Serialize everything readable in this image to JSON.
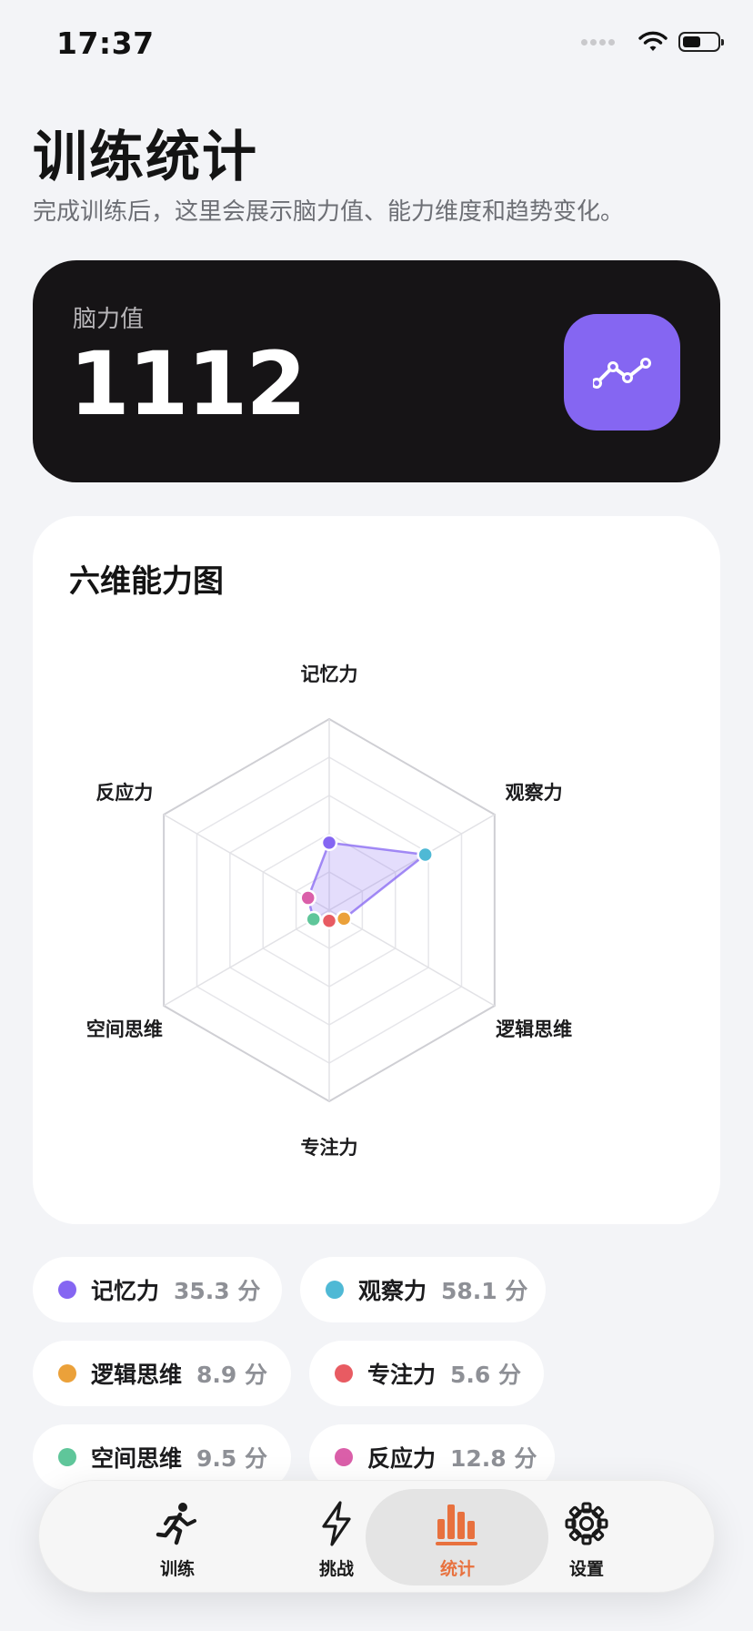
{
  "status_bar": {
    "time": "17:37",
    "battery_level": 0.55
  },
  "header": {
    "title": "训练统计",
    "subtitle": "完成训练后，这里会展示脑力值、能力维度和趋势变化。"
  },
  "score_card": {
    "label": "脑力值",
    "value": "1112",
    "trend_icon": "trend-line-icon",
    "accent_color": "#8566f2"
  },
  "radar": {
    "title": "六维能力图",
    "max_value": 100,
    "fill_color": "#8566f2",
    "axes": [
      {
        "name": "记忆力",
        "value": 35.3,
        "color": "#8566f2"
      },
      {
        "name": "观察力",
        "value": 58.1,
        "color": "#4fb9d5"
      },
      {
        "name": "逻辑思维",
        "value": 8.9,
        "color": "#eba13a"
      },
      {
        "name": "专注力",
        "value": 5.6,
        "color": "#e85b62"
      },
      {
        "name": "空间思维",
        "value": 9.5,
        "color": "#5fc69a"
      },
      {
        "name": "反应力",
        "value": 12.8,
        "color": "#da5fa9"
      }
    ]
  },
  "legend": [
    {
      "name": "记忆力",
      "score": "35.3 分",
      "color": "#8566f2"
    },
    {
      "name": "观察力",
      "score": "58.1 分",
      "color": "#4fb9d5"
    },
    {
      "name": "逻辑思维",
      "score": "8.9 分",
      "color": "#eba13a"
    },
    {
      "name": "专注力",
      "score": "5.6 分",
      "color": "#e85b62"
    },
    {
      "name": "空间思维",
      "score": "9.5 分",
      "color": "#5fc69a"
    },
    {
      "name": "反应力",
      "score": "12.8 分",
      "color": "#da5fa9"
    }
  ],
  "tab_bar": {
    "active_color": "#e8713e",
    "items": [
      {
        "label": "训练",
        "icon": "running-person-icon",
        "active": false
      },
      {
        "label": "挑战",
        "icon": "lightning-bolt-icon",
        "active": false
      },
      {
        "label": "统计",
        "icon": "bar-chart-icon",
        "active": true
      },
      {
        "label": "设置",
        "icon": "gear-icon",
        "active": false
      }
    ]
  }
}
